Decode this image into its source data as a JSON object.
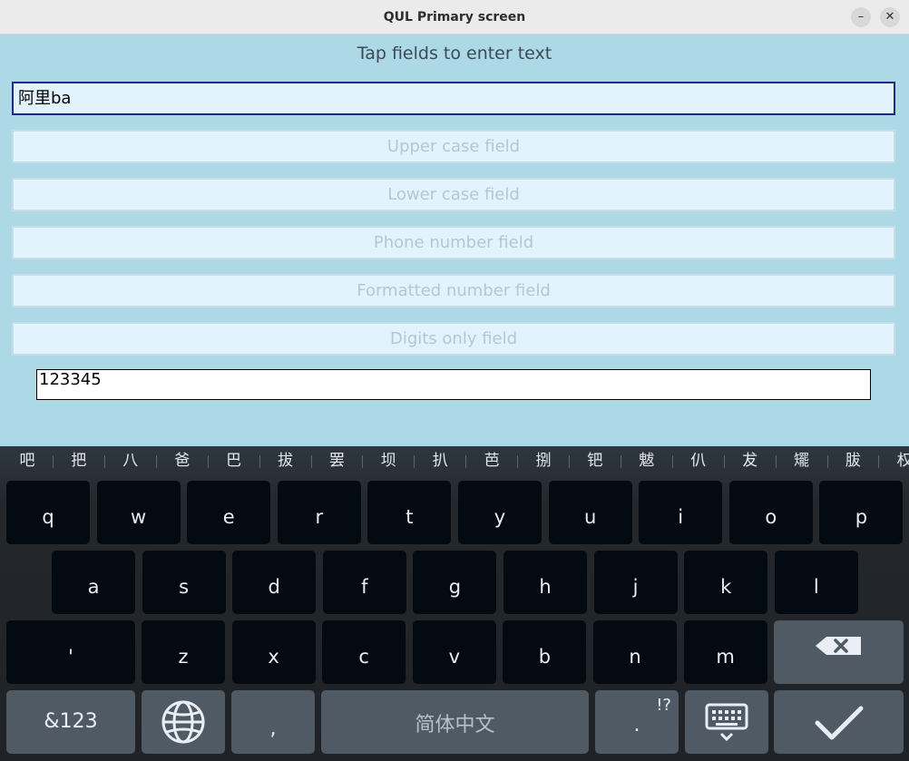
{
  "window": {
    "title": "QUL Primary screen",
    "minimize_glyph": "–",
    "close_glyph": "✕"
  },
  "screen": {
    "prompt": "Tap fields to enter text",
    "active_field_value": "阿里ba",
    "upper_placeholder": "Upper case field",
    "lower_placeholder": "Lower case field",
    "phone_placeholder": "Phone number field",
    "formatted_placeholder": "Formatted number field",
    "digits_placeholder": "Digits only field",
    "plain_field_value": "123345"
  },
  "keyboard": {
    "candidates": [
      "吧",
      "把",
      "八",
      "爸",
      "巴",
      "拔",
      "罢",
      "坝",
      "扒",
      "芭",
      "捌",
      "钯",
      "魃",
      "仈",
      "犮",
      "矲",
      "胈",
      "权"
    ],
    "row1": [
      "q",
      "w",
      "e",
      "r",
      "t",
      "y",
      "u",
      "i",
      "o",
      "p"
    ],
    "row2": [
      "a",
      "s",
      "d",
      "f",
      "g",
      "h",
      "j",
      "k",
      "l"
    ],
    "row3": [
      "'",
      "z",
      "x",
      "c",
      "v",
      "b",
      "n",
      "m"
    ],
    "symbols_label": "&123",
    "comma_label": ",",
    "space_label": "简体中文",
    "period_label": ".",
    "period_alt_label": "!?",
    "icons": {
      "backspace": "backspace-icon",
      "globe": "globe-icon",
      "hide": "keyboard-hide-icon",
      "enter": "checkmark-icon"
    }
  }
}
